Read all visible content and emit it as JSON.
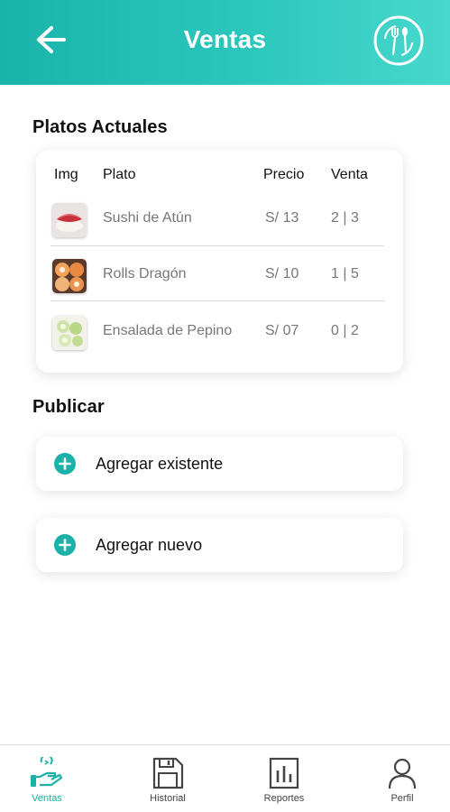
{
  "header": {
    "title": "Ventas",
    "back_icon": "arrow-left-icon",
    "logo_icon": "plate-fork-spoon-logo-icon"
  },
  "platos": {
    "section_title": "Platos Actuales",
    "columns": [
      "Img",
      "Plato",
      "Precio",
      "Venta"
    ],
    "rows": [
      {
        "name": "Sushi de Atún",
        "price": "S/ 13",
        "venta": "2 | 3",
        "image": "tuna-sushi"
      },
      {
        "name": "Rolls Dragón",
        "price": "S/ 10",
        "venta": "1 | 5",
        "image": "dragon-rolls"
      },
      {
        "name": "Ensalada de Pepino",
        "price": "S/ 07",
        "venta": "0 | 2",
        "image": "cucumber-salad"
      }
    ]
  },
  "publicar": {
    "section_title": "Publicar",
    "add_existing_label": "Agregar existente",
    "add_new_label": "Agregar nuevo"
  },
  "nav": {
    "items": [
      {
        "label": "Ventas",
        "icon": "sales-hand-icon",
        "active": true
      },
      {
        "label": "Historial",
        "icon": "save-floppy-icon",
        "active": false
      },
      {
        "label": "Reportes",
        "icon": "bar-chart-icon",
        "active": false
      },
      {
        "label": "Perfil",
        "icon": "user-icon",
        "active": false
      }
    ]
  },
  "colors": {
    "accent": "#1bb1a8",
    "header_start": "#19b3aa",
    "header_end": "#47d8cd",
    "muted_text": "#777777"
  }
}
